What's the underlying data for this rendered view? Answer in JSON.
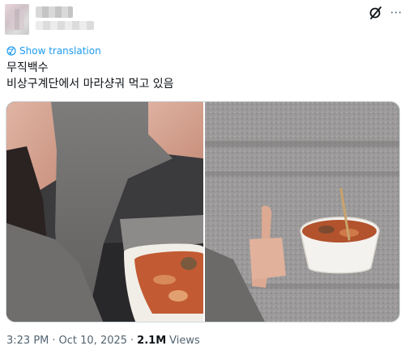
{
  "tweet": {
    "author_avatar": "blurred-avatar",
    "show_translation": "Show translation",
    "text_line1": "무직백수",
    "text_line2": "비상구계단에서 마라샹궈 먹고 있음",
    "time": "3:23 PM",
    "separator": "·",
    "date": "Oct 10, 2025",
    "views_count": "2.1M",
    "views_label": "Views"
  },
  "icons": {
    "grok": "grok-icon",
    "more": "more-icon",
    "translate": "globe-icon"
  },
  "colors": {
    "link": "#1d9bf0",
    "text": "#0f1419",
    "muted": "#536471"
  }
}
